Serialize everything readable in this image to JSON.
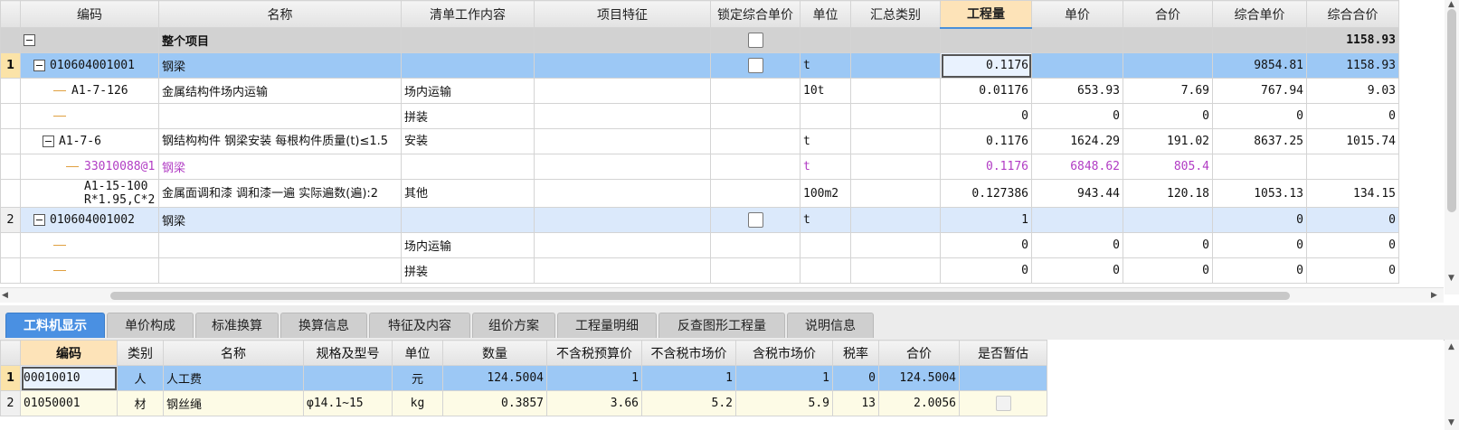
{
  "upper": {
    "columns": [
      "编码",
      "名称",
      "清单工作内容",
      "项目特征",
      "锁定综合单价",
      "单位",
      "汇总类别",
      "工程量",
      "单价",
      "合价",
      "综合单价",
      "综合合价"
    ],
    "root": {
      "name": "整个项目",
      "total": "1158.93"
    },
    "rows": [
      {
        "num": "1",
        "code": "010604001001",
        "name": "钢梁",
        "content": "",
        "unit": "t",
        "qty": "0.1176",
        "price": "",
        "amount": "",
        "unit_price": "9854.81",
        "total": "1158.93"
      },
      {
        "num": "",
        "code": "A1-7-126",
        "name": "金属结构件场内运输",
        "content": "场内运输",
        "unit": "10t",
        "qty": "0.01176",
        "price": "653.93",
        "amount": "7.69",
        "unit_price": "767.94",
        "total": "9.03"
      },
      {
        "num": "",
        "code": "",
        "name": "",
        "content": "拼装",
        "unit": "",
        "qty": "0",
        "price": "0",
        "amount": "0",
        "unit_price": "0",
        "total": "0"
      },
      {
        "num": "",
        "code": "A1-7-6",
        "name": "钢结构构件 钢梁安装 每根构件质量(t)≤1.5",
        "content": "安装",
        "unit": "t",
        "qty": "0.1176",
        "price": "1624.29",
        "amount": "191.02",
        "unit_price": "8637.25",
        "total": "1015.74"
      },
      {
        "num": "",
        "code": "33010088@1",
        "name": "钢梁",
        "content": "",
        "unit": "t",
        "qty": "0.1176",
        "price": "6848.62",
        "amount": "805.4",
        "unit_price": "",
        "total": ""
      },
      {
        "num": "",
        "code": "A1-15-100 R*1.95,C*2",
        "name": "金属面调和漆 调和漆一遍  实际遍数(遍):2",
        "content": "其他",
        "unit": "100m2",
        "qty": "0.127386",
        "price": "943.44",
        "amount": "120.18",
        "unit_price": "1053.13",
        "total": "134.15"
      },
      {
        "num": "2",
        "code": "010604001002",
        "name": "钢梁",
        "content": "",
        "unit": "t",
        "qty": "1",
        "price": "",
        "amount": "",
        "unit_price": "0",
        "total": "0"
      },
      {
        "num": "",
        "code": "",
        "name": "",
        "content": "场内运输",
        "unit": "",
        "qty": "0",
        "price": "0",
        "amount": "0",
        "unit_price": "0",
        "total": "0"
      },
      {
        "num": "",
        "code": "",
        "name": "",
        "content": "拼装",
        "unit": "",
        "qty": "0",
        "price": "0",
        "amount": "0",
        "unit_price": "0",
        "total": "0"
      }
    ]
  },
  "tabs": [
    "工料机显示",
    "单价构成",
    "标准换算",
    "换算信息",
    "特征及内容",
    "组价方案",
    "工程量明细",
    "反查图形工程量",
    "说明信息"
  ],
  "lower": {
    "columns": [
      "编码",
      "类别",
      "名称",
      "规格及型号",
      "单位",
      "数量",
      "不含税预算价",
      "不含税市场价",
      "含税市场价",
      "税率",
      "合价",
      "是否暂估"
    ],
    "rows": [
      {
        "num": "1",
        "code": "00010010",
        "type": "人",
        "name": "人工费",
        "spec": "",
        "unit": "元",
        "qty": "124.5004",
        "budget": "1",
        "market": "1",
        "tax_market": "1",
        "rate": "0",
        "total": "124.5004"
      },
      {
        "num": "2",
        "code": "01050001",
        "type": "材",
        "name": "钢丝绳",
        "spec": "φ14.1~15",
        "unit": "kg",
        "qty": "0.3857",
        "budget": "3.66",
        "market": "5.2",
        "tax_market": "5.9",
        "rate": "13",
        "total": "2.0056"
      }
    ]
  }
}
